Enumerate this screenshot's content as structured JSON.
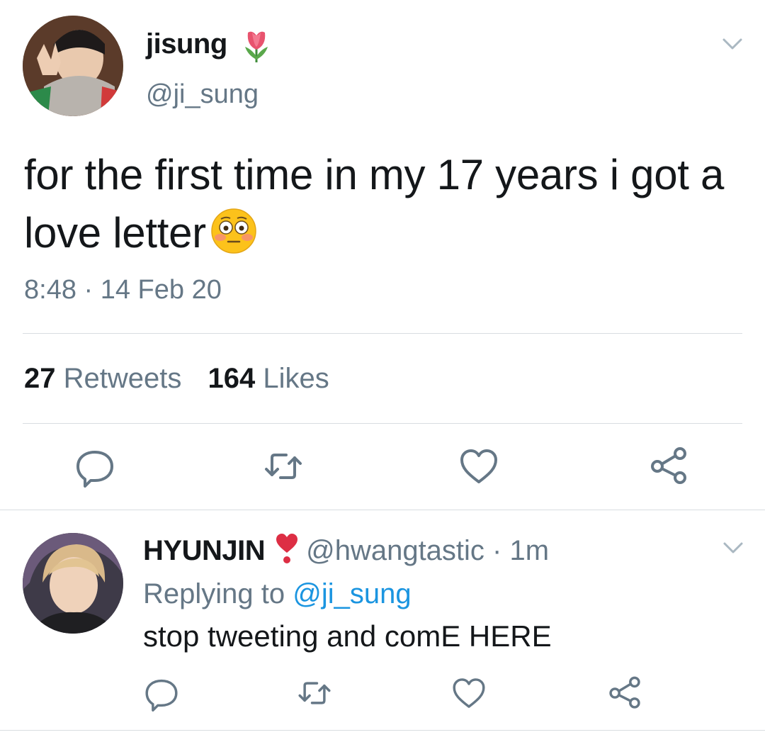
{
  "tweet": {
    "display_name": "jisung",
    "name_emoji": "tulip-emoji",
    "handle": "@ji_sung",
    "text": "for the first time in my 17 years i got a love letter",
    "text_emoji": "flushed-face-emoji",
    "timestamp": "8:48 · 14 Feb 20",
    "retweet_count": "27",
    "retweet_label": "Retweets",
    "like_count": "164",
    "like_label": "Likes"
  },
  "reply": {
    "display_name": "HYUNJIN",
    "name_emoji": "red-exclamation-heart-emoji",
    "handle_time": "@hwangtastic · 1m",
    "replying_prefix": "Replying to",
    "replying_to": "@ji_sung",
    "text": "stop tweeting and comE HERE"
  },
  "colors": {
    "text": "#14171a",
    "secondary": "#657786",
    "link": "#1b95e0",
    "divider": "#d9dde1"
  },
  "icons": [
    "reply-icon",
    "retweet-icon",
    "like-icon",
    "share-icon",
    "chevron-down-icon"
  ]
}
